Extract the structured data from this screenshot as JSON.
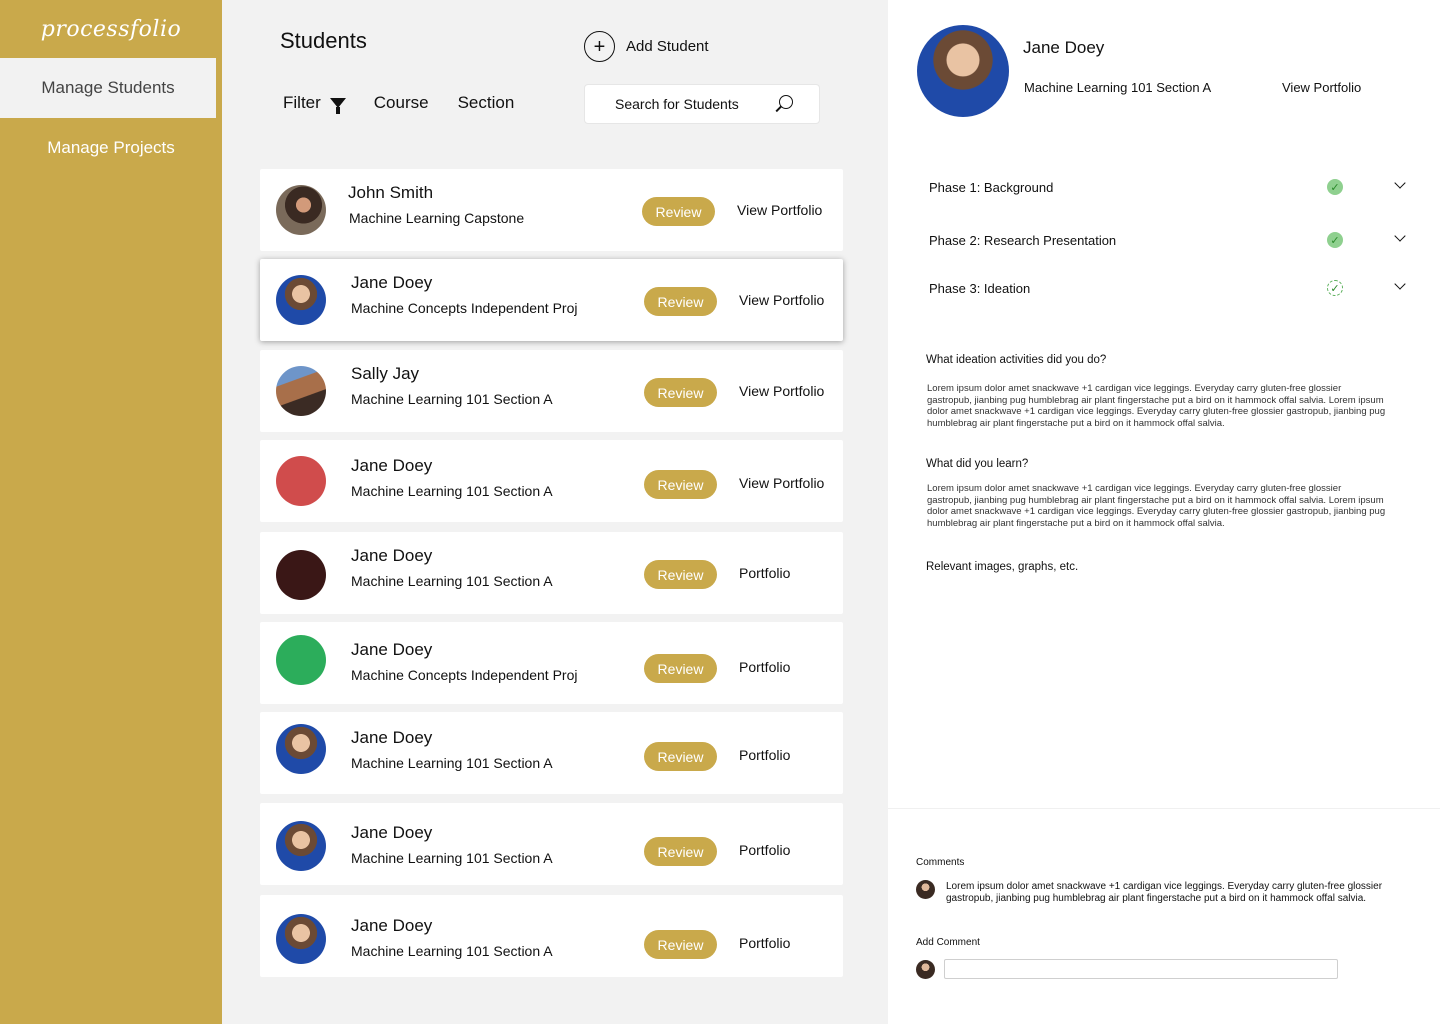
{
  "app": {
    "logo": "processfolio"
  },
  "sidebar": {
    "items": [
      {
        "label": "Manage Students"
      },
      {
        "label": "Manage Projects"
      }
    ]
  },
  "main": {
    "title": "Students",
    "add_student_label": "Add Student",
    "filter_label": "Filter",
    "course_label": "Course",
    "section_label": "Section",
    "search_placeholder": "Search for Students"
  },
  "students": [
    {
      "name": "John Smith",
      "course": "Machine Learning Capstone",
      "review": "Review",
      "portfolio": "View Portfolio"
    },
    {
      "name": "Jane Doey",
      "course": "Machine Concepts Independent Proj",
      "review": "Review",
      "portfolio": "View Portfolio"
    },
    {
      "name": "Sally Jay",
      "course": "Machine Learning 101 Section A",
      "review": "Review",
      "portfolio": "View Portfolio"
    },
    {
      "name": "Jane Doey",
      "course": "Machine Learning 101 Section A",
      "review": "Review",
      "portfolio": "View Portfolio",
      "avatar_color": "#d04c4c"
    },
    {
      "name": "Jane Doey",
      "course": "Machine Learning 101 Section A",
      "review": "Review",
      "portfolio": "Portfolio",
      "avatar_color": "#3a1716"
    },
    {
      "name": "Jane Doey",
      "course": "Machine Concepts Independent Proj",
      "review": "Review",
      "portfolio": "Portfolio",
      "avatar_color": "#2cad5b"
    },
    {
      "name": "Jane Doey",
      "course": "Machine Learning 101 Section A",
      "review": "Review",
      "portfolio": "Portfolio"
    },
    {
      "name": "Jane Doey",
      "course": "Machine Learning 101 Section A",
      "review": "Review",
      "portfolio": "Portfolio"
    },
    {
      "name": "Jane Doey",
      "course": "Machine Learning 101 Section A",
      "review": "Review",
      "portfolio": "Portfolio"
    }
  ],
  "detail": {
    "name": "Jane Doey",
    "course": "Machine Learning 101 Section A",
    "portfolio_link": "View Portfolio",
    "phases": [
      {
        "label": "Phase 1: Background",
        "status": "complete"
      },
      {
        "label": "Phase 2: Research Presentation",
        "status": "complete"
      },
      {
        "label": "Phase 3: Ideation",
        "status": "in-progress"
      }
    ],
    "questions": [
      {
        "title": "What ideation activities did you do?",
        "body": "Lorem ipsum dolor amet snackwave +1 cardigan vice leggings. Everyday carry gluten-free glossier gastropub, jianbing pug humblebrag air plant fingerstache put a bird on it hammock offal salvia. Lorem ipsum dolor amet snackwave +1 cardigan vice leggings. Everyday carry gluten-free glossier gastropub, jianbing pug humblebrag air plant fingerstache put a bird on it hammock offal salvia."
      },
      {
        "title": "What did you learn?",
        "body": "Lorem ipsum dolor amet snackwave +1 cardigan vice leggings. Everyday carry gluten-free glossier gastropub, jianbing pug humblebrag air plant fingerstache put a bird on it hammock offal salvia. Lorem ipsum dolor amet snackwave +1 cardigan vice leggings. Everyday carry gluten-free glossier gastropub, jianbing pug humblebrag air plant fingerstache put a bird on it hammock offal salvia."
      }
    ],
    "images_label": "Relevant images, graphs, etc."
  },
  "comments": {
    "title": "Comments",
    "items": [
      {
        "text": "Lorem ipsum dolor amet snackwave +1 cardigan vice leggings. Everyday carry gluten-free glossier gastropub, jianbing pug humblebrag air plant fingerstache put a bird on it hammock offal salvia."
      }
    ],
    "add_label": "Add Comment",
    "input_value": ""
  },
  "colors": {
    "accent": "#c9a94b",
    "background": "#f2f2f2"
  }
}
